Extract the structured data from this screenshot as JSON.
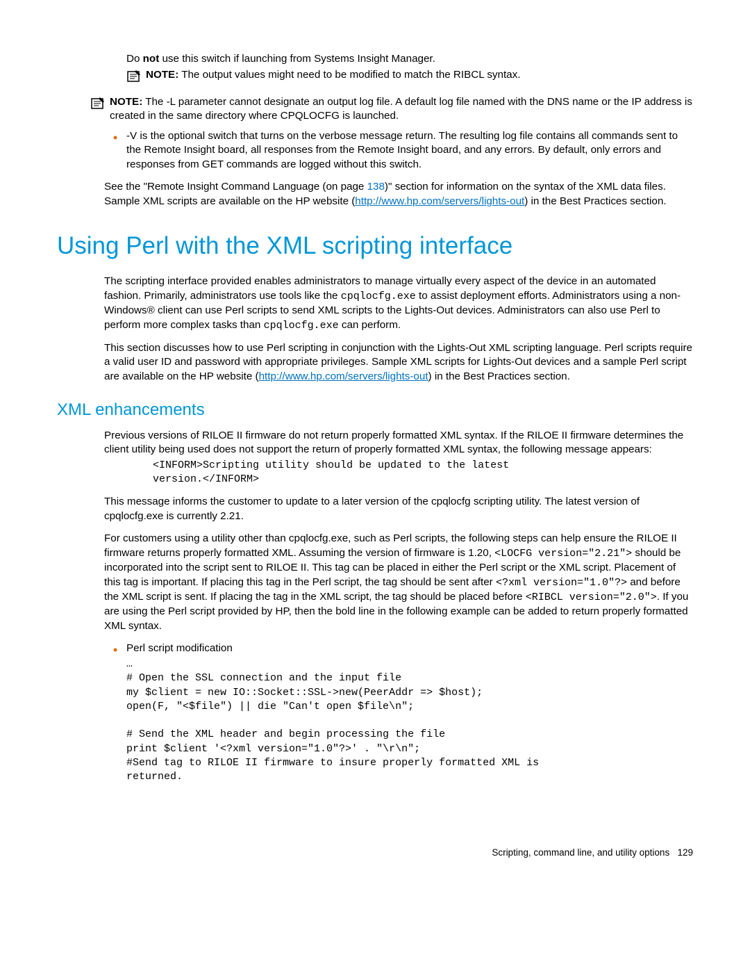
{
  "top": {
    "line1_pre": "Do ",
    "line1_bold": "not",
    "line1_post": " use this switch if launching from Systems Insight Manager.",
    "note1_label": "NOTE:",
    "note1_text": " The output values might need to be modified to match the RIBCL syntax."
  },
  "note2": {
    "label": "NOTE:",
    "text": " The -L parameter cannot designate an output log file. A default log file named with the DNS name or the IP address is created in the same directory where CPQLOCFG is launched."
  },
  "bullet_v": "-V is the optional switch that turns on the verbose message return. The resulting log file contains all commands sent to the Remote Insight board, all responses from the Remote Insight board, and any errors. By default, only errors and responses from GET commands are logged without this switch.",
  "see_para": {
    "pre": "See the \"Remote Insight Command Language (on page ",
    "pageref": "138",
    "mid": ")\" section for information on the syntax of the XML data files. Sample XML scripts are available on the HP website (",
    "link": "http://www.hp.com/servers/lights-out",
    "post": ") in the Best Practices section."
  },
  "h1": "Using Perl with the XML scripting interface",
  "perl_p1": {
    "a": "The scripting interface provided enables administrators to manage virtually every aspect of the device in an automated fashion. Primarily, administrators use tools like the ",
    "code1": "cpqlocfg.exe",
    "b": " to assist deployment efforts. Administrators using a non-Windows® client can use Perl scripts to send XML scripts to the Lights-Out devices. Administrators can also use Perl to perform more complex tasks than ",
    "code2": "cpqlocfg.exe",
    "c": " can perform."
  },
  "perl_p2": {
    "a": "This section discusses how to use Perl scripting in conjunction with the Lights-Out XML scripting language. Perl scripts require a valid user ID and password with appropriate privileges. Sample XML scripts for Lights-Out devices and a sample Perl script are available on the HP website (",
    "link": "http://www.hp.com/servers/lights-out",
    "b": ") in the Best Practices section."
  },
  "h2": "XML enhancements",
  "xml_p1": "Previous versions of RILOE II firmware do not return properly formatted XML syntax. If the RILOE II firmware determines the client utility being used does not support the return of properly formatted XML syntax, the following message appears:",
  "code1": "<INFORM>Scripting utility should be updated to the latest\nversion.</INFORM>",
  "xml_p2": "This message informs the customer to update to a later version of the cpqlocfg scripting utility. The latest version of cpqlocfg.exe is currently 2.21.",
  "xml_p3": {
    "a": "For customers using a utility other than cpqlocfg.exe, such as Perl scripts, the following steps can help ensure the RILOE II firmware returns properly formatted XML. Assuming the version of firmware is 1.20, ",
    "c1": "<LOCFG version=\"2.21\">",
    "b": " should be incorporated into the script sent to RILOE II. This tag can be placed in either the Perl script or the XML script. Placement of this tag is important. If placing this tag in the Perl script, the tag should be sent after ",
    "c2": "<?xml version=\"1.0\"?>",
    "c": " and before the XML script is sent. If placing the tag in the XML script, the tag should be placed before ",
    "c3": "<RIBCL version=\"2.0\">",
    "d": ". If you are using the Perl script provided by HP, then the bold line in the following example can be added to return properly formatted XML syntax."
  },
  "bullet_perl": "Perl script modification",
  "code2": "…\n# Open the SSL connection and the input file\nmy $client = new IO::Socket::SSL->new(PeerAddr => $host);\nopen(F, \"<$file\") || die \"Can't open $file\\n\";\n\n# Send the XML header and begin processing the file\nprint $client '<?xml version=\"1.0\"?>' . \"\\r\\n\";\n#Send tag to RILOE II firmware to insure properly formatted XML is\nreturned.",
  "footer": {
    "text": "Scripting, command line, and utility options",
    "page": "129"
  },
  "icon_name": "note-icon"
}
